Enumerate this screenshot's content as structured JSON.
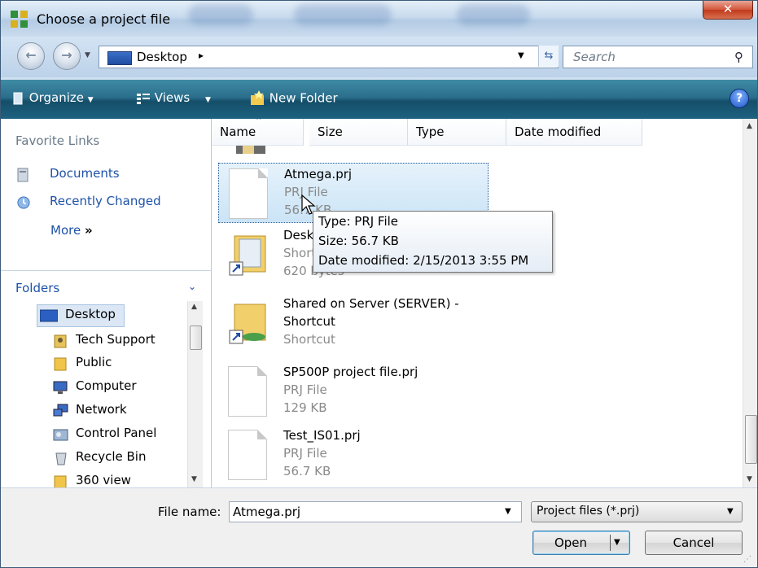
{
  "window": {
    "title": "Choose a project file",
    "close_label": "✕"
  },
  "address_bar": {
    "location": "Desktop",
    "separator": "▸",
    "search_placeholder": "Search"
  },
  "toolbar": {
    "organize": "Organize",
    "views": "Views",
    "new_folder": "New Folder",
    "help": "?"
  },
  "favorite_links": {
    "title": "Favorite Links",
    "items": [
      {
        "label": "Documents",
        "icon": "documents-icon"
      },
      {
        "label": "Recently Changed",
        "icon": "recently-changed-icon"
      }
    ],
    "more": "More",
    "more_arrow": "»"
  },
  "folders": {
    "title": "Folders",
    "tree": [
      {
        "label": "Desktop",
        "icon": "desktop-icon",
        "selected": true
      },
      {
        "label": "Tech Support",
        "icon": "user-folder-icon"
      },
      {
        "label": "Public",
        "icon": "folder-icon"
      },
      {
        "label": "Computer",
        "icon": "computer-icon"
      },
      {
        "label": "Network",
        "icon": "network-icon"
      },
      {
        "label": "Control Panel",
        "icon": "control-panel-icon"
      },
      {
        "label": "Recycle Bin",
        "icon": "recycle-bin-icon"
      },
      {
        "label": "360 view",
        "icon": "folder-icon"
      }
    ]
  },
  "columns": [
    "Name",
    "Size",
    "Type",
    "Date modified"
  ],
  "files": [
    {
      "name": "Atmega.prj",
      "type": "PRJ File",
      "size": "56.7 KB",
      "selected": true
    },
    {
      "name": "Desktop",
      "type": "Shortcut",
      "size": "620 bytes",
      "kind": "shortcut-folder"
    },
    {
      "name": "Shared on Server (SERVER) -",
      "name2": "Shortcut",
      "type": "Shortcut",
      "kind": "shortcut-folder"
    },
    {
      "name": "SP500P project file.prj",
      "type": "PRJ File",
      "size": "129 KB"
    },
    {
      "name": "Test_IS01.prj",
      "type": "PRJ File",
      "size": "56.7 KB"
    }
  ],
  "tooltip": {
    "type": "Type: PRJ File",
    "size": "Size: 56.7 KB",
    "date": "Date modified: 2/15/2013 3:55 PM"
  },
  "bottom": {
    "file_name_label": "File name:",
    "file_name_value": "Atmega.prj",
    "filter": "Project files (*.prj)",
    "open": "Open",
    "cancel": "Cancel"
  },
  "colors": {
    "link": "#1e52a8",
    "toolbar": "#1d6280",
    "selection": "#cbe4f6"
  }
}
